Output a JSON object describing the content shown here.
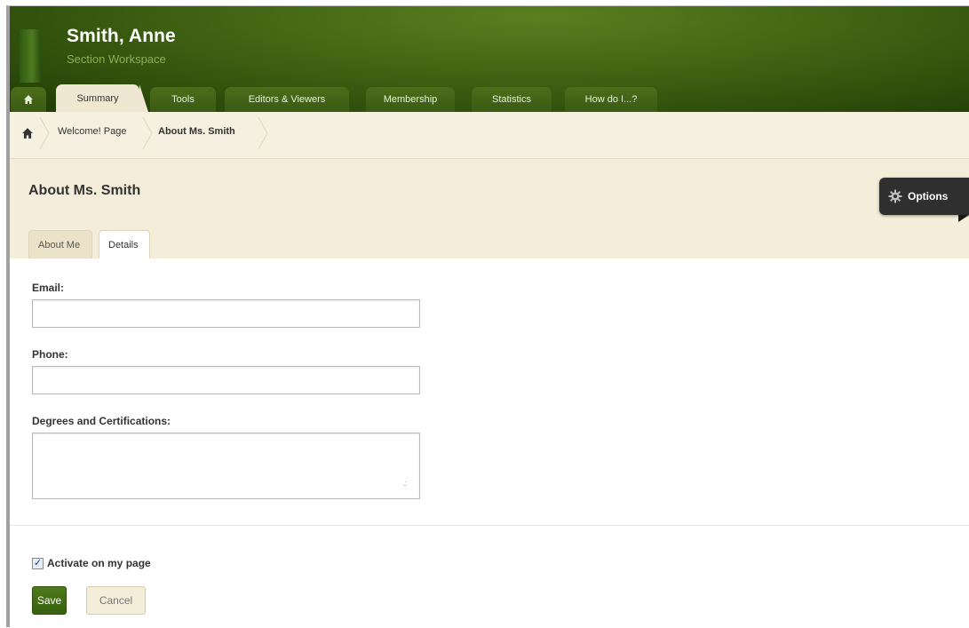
{
  "header": {
    "title": "Smith, Anne",
    "subtitle": "Section Workspace"
  },
  "nav": {
    "tabs": [
      {
        "label": "Summary"
      },
      {
        "label": "Tools"
      },
      {
        "label": "Editors & Viewers"
      },
      {
        "label": "Membership"
      },
      {
        "label": "Statistics"
      },
      {
        "label": "How do I...?"
      }
    ],
    "active": "Summary"
  },
  "breadcrumb": {
    "items": [
      {
        "label": "Welcome! Page"
      },
      {
        "label": "About Ms. Smith"
      }
    ]
  },
  "page": {
    "title": "About Ms. Smith",
    "options_label": "Options"
  },
  "subtabs": {
    "items": [
      {
        "label": "About Me"
      },
      {
        "label": "Details"
      }
    ],
    "active": "Details"
  },
  "form": {
    "email": {
      "label": "Email:",
      "value": ""
    },
    "phone": {
      "label": "Phone:",
      "value": ""
    },
    "degrees": {
      "label": "Degrees and Certifications:",
      "value": ""
    },
    "activate": {
      "label": "Activate on my page",
      "checked": true
    }
  },
  "buttons": {
    "save": "Save",
    "cancel": "Cancel"
  },
  "colors": {
    "header_green": "#3f6312",
    "beige": "#f4edd9",
    "save_green": "#4e7a1c"
  }
}
